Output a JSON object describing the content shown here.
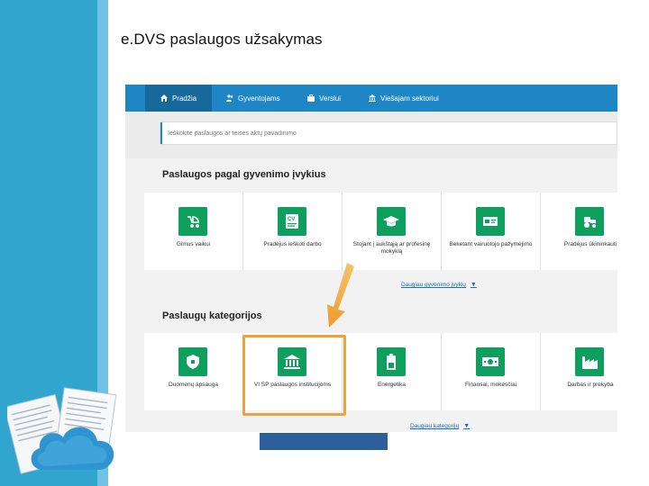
{
  "slide": {
    "title": "e.DVS paslaugos užsakymas"
  },
  "nav": {
    "items": [
      {
        "label": "Pradžia",
        "icon": "home-icon"
      },
      {
        "label": "Gyventojams",
        "icon": "users-icon"
      },
      {
        "label": "Verslui",
        "icon": "briefcase-icon"
      },
      {
        "label": "Viešajam sektoriui",
        "icon": "bank-icon"
      }
    ]
  },
  "search": {
    "placeholder": "Ieškokite paslaugos ar teisės aktų pavadinimo"
  },
  "life_events": {
    "title": "Paslaugos pagal gyvenimo įvykius",
    "tiles": [
      {
        "label": "Gimus vaikui",
        "icon": "stroller-icon"
      },
      {
        "label": "Pradėjus ieškoti darbo",
        "icon": "cv-icon"
      },
      {
        "label": "Stojant į aukštąją ar profesinę mokyklą",
        "icon": "graduation-cap-icon"
      },
      {
        "label": "Beketant vairuotojo pažymėjimo",
        "icon": "car-icon"
      },
      {
        "label": "Pradėjus ūkininkauti",
        "icon": "tractor-icon"
      }
    ],
    "more_label": "Daugiau gyvenimo įvykių"
  },
  "categories": {
    "title": "Paslaugų kategorijos",
    "tiles": [
      {
        "label": "Duomenų apsauga",
        "icon": "shield-icon"
      },
      {
        "label": "VI SP paslaugos institucijoms",
        "icon": "institution-icon"
      },
      {
        "label": "Energetika",
        "icon": "battery-icon"
      },
      {
        "label": "Finansai, mokesčiai",
        "icon": "money-icon"
      },
      {
        "label": "Darbas ir prekyba",
        "icon": "factory-icon"
      }
    ],
    "more_label": "Daugiau kategorijų"
  },
  "colors": {
    "nav": "#1e86c4",
    "tile_icon": "#0e9e5d",
    "highlight": "#f0a23a",
    "slide_accent": "#30a6cf"
  }
}
